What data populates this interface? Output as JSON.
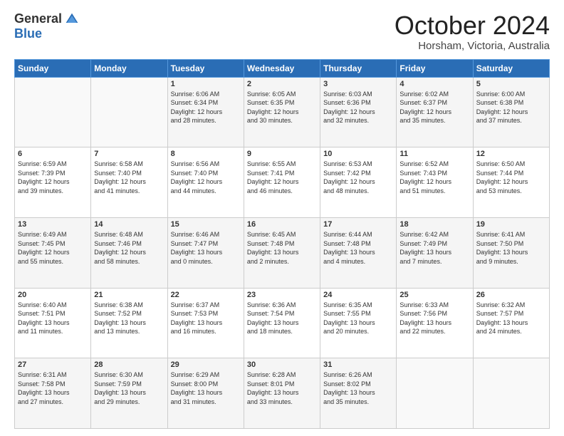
{
  "logo": {
    "general": "General",
    "blue": "Blue"
  },
  "header": {
    "month": "October 2024",
    "location": "Horsham, Victoria, Australia"
  },
  "weekdays": [
    "Sunday",
    "Monday",
    "Tuesday",
    "Wednesday",
    "Thursday",
    "Friday",
    "Saturday"
  ],
  "weeks": [
    [
      {
        "day": "",
        "info": ""
      },
      {
        "day": "",
        "info": ""
      },
      {
        "day": "1",
        "info": "Sunrise: 6:06 AM\nSunset: 6:34 PM\nDaylight: 12 hours\nand 28 minutes."
      },
      {
        "day": "2",
        "info": "Sunrise: 6:05 AM\nSunset: 6:35 PM\nDaylight: 12 hours\nand 30 minutes."
      },
      {
        "day": "3",
        "info": "Sunrise: 6:03 AM\nSunset: 6:36 PM\nDaylight: 12 hours\nand 32 minutes."
      },
      {
        "day": "4",
        "info": "Sunrise: 6:02 AM\nSunset: 6:37 PM\nDaylight: 12 hours\nand 35 minutes."
      },
      {
        "day": "5",
        "info": "Sunrise: 6:00 AM\nSunset: 6:38 PM\nDaylight: 12 hours\nand 37 minutes."
      }
    ],
    [
      {
        "day": "6",
        "info": "Sunrise: 6:59 AM\nSunset: 7:39 PM\nDaylight: 12 hours\nand 39 minutes."
      },
      {
        "day": "7",
        "info": "Sunrise: 6:58 AM\nSunset: 7:40 PM\nDaylight: 12 hours\nand 41 minutes."
      },
      {
        "day": "8",
        "info": "Sunrise: 6:56 AM\nSunset: 7:40 PM\nDaylight: 12 hours\nand 44 minutes."
      },
      {
        "day": "9",
        "info": "Sunrise: 6:55 AM\nSunset: 7:41 PM\nDaylight: 12 hours\nand 46 minutes."
      },
      {
        "day": "10",
        "info": "Sunrise: 6:53 AM\nSunset: 7:42 PM\nDaylight: 12 hours\nand 48 minutes."
      },
      {
        "day": "11",
        "info": "Sunrise: 6:52 AM\nSunset: 7:43 PM\nDaylight: 12 hours\nand 51 minutes."
      },
      {
        "day": "12",
        "info": "Sunrise: 6:50 AM\nSunset: 7:44 PM\nDaylight: 12 hours\nand 53 minutes."
      }
    ],
    [
      {
        "day": "13",
        "info": "Sunrise: 6:49 AM\nSunset: 7:45 PM\nDaylight: 12 hours\nand 55 minutes."
      },
      {
        "day": "14",
        "info": "Sunrise: 6:48 AM\nSunset: 7:46 PM\nDaylight: 12 hours\nand 58 minutes."
      },
      {
        "day": "15",
        "info": "Sunrise: 6:46 AM\nSunset: 7:47 PM\nDaylight: 13 hours\nand 0 minutes."
      },
      {
        "day": "16",
        "info": "Sunrise: 6:45 AM\nSunset: 7:48 PM\nDaylight: 13 hours\nand 2 minutes."
      },
      {
        "day": "17",
        "info": "Sunrise: 6:44 AM\nSunset: 7:48 PM\nDaylight: 13 hours\nand 4 minutes."
      },
      {
        "day": "18",
        "info": "Sunrise: 6:42 AM\nSunset: 7:49 PM\nDaylight: 13 hours\nand 7 minutes."
      },
      {
        "day": "19",
        "info": "Sunrise: 6:41 AM\nSunset: 7:50 PM\nDaylight: 13 hours\nand 9 minutes."
      }
    ],
    [
      {
        "day": "20",
        "info": "Sunrise: 6:40 AM\nSunset: 7:51 PM\nDaylight: 13 hours\nand 11 minutes."
      },
      {
        "day": "21",
        "info": "Sunrise: 6:38 AM\nSunset: 7:52 PM\nDaylight: 13 hours\nand 13 minutes."
      },
      {
        "day": "22",
        "info": "Sunrise: 6:37 AM\nSunset: 7:53 PM\nDaylight: 13 hours\nand 16 minutes."
      },
      {
        "day": "23",
        "info": "Sunrise: 6:36 AM\nSunset: 7:54 PM\nDaylight: 13 hours\nand 18 minutes."
      },
      {
        "day": "24",
        "info": "Sunrise: 6:35 AM\nSunset: 7:55 PM\nDaylight: 13 hours\nand 20 minutes."
      },
      {
        "day": "25",
        "info": "Sunrise: 6:33 AM\nSunset: 7:56 PM\nDaylight: 13 hours\nand 22 minutes."
      },
      {
        "day": "26",
        "info": "Sunrise: 6:32 AM\nSunset: 7:57 PM\nDaylight: 13 hours\nand 24 minutes."
      }
    ],
    [
      {
        "day": "27",
        "info": "Sunrise: 6:31 AM\nSunset: 7:58 PM\nDaylight: 13 hours\nand 27 minutes."
      },
      {
        "day": "28",
        "info": "Sunrise: 6:30 AM\nSunset: 7:59 PM\nDaylight: 13 hours\nand 29 minutes."
      },
      {
        "day": "29",
        "info": "Sunrise: 6:29 AM\nSunset: 8:00 PM\nDaylight: 13 hours\nand 31 minutes."
      },
      {
        "day": "30",
        "info": "Sunrise: 6:28 AM\nSunset: 8:01 PM\nDaylight: 13 hours\nand 33 minutes."
      },
      {
        "day": "31",
        "info": "Sunrise: 6:26 AM\nSunset: 8:02 PM\nDaylight: 13 hours\nand 35 minutes."
      },
      {
        "day": "",
        "info": ""
      },
      {
        "day": "",
        "info": ""
      }
    ]
  ]
}
